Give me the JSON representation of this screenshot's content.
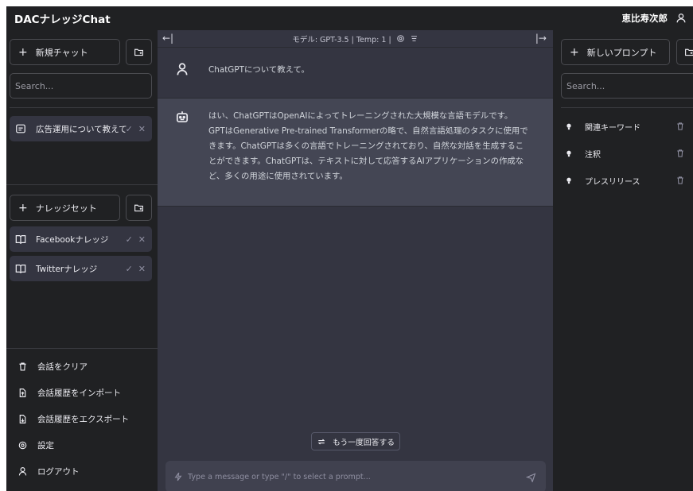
{
  "app": {
    "title": "DACナレッジChat",
    "user_name": "恵比寿次郎"
  },
  "left": {
    "new_chat_label": "新規チャット",
    "search_placeholder": "Search...",
    "conversations": [
      {
        "label": "広告運用について教えて"
      }
    ],
    "knowledge_set_label": "ナレッジセット",
    "knowledge": [
      {
        "label": "Facebookナレッジ"
      },
      {
        "label": "Twitterナレッジ"
      }
    ],
    "menu": {
      "clear": "会話をクリア",
      "import": "会話履歴をインポート",
      "export": "会話履歴をエクスポート",
      "settings": "設定",
      "logout": "ログアウト"
    }
  },
  "center": {
    "header": "モデル: GPT-3.5 | Temp: 1 |",
    "user_message": "ChatGPTについて教えて。",
    "bot_lines": [
      "はい、ChatGPTはOpenAIによってトレーニングされた大規模な言語モデルです。",
      "GPTはGenerative Pre-trained Transformerの略で、自然言語処理のタスクに使用で",
      "きます。ChatGPTは多くの言語でトレーニングされており、自然な対話を生成するこ",
      "とができます。ChatGPTは、テキストに対して応答するAIアプリケーションの作成な",
      "ど、多くの用途に使用されています。"
    ],
    "regenerate_label": "もう一度回答する",
    "input_placeholder": "Type a message or type \"/\" to select a prompt..."
  },
  "right": {
    "new_prompt_label": "新しいプロンプト",
    "search_placeholder": "Search...",
    "prompts": [
      {
        "label": "関連キーワード"
      },
      {
        "label": "注釈"
      },
      {
        "label": "プレスリリース"
      }
    ]
  },
  "colors": {
    "sidebar_bg": "#202123",
    "chat_bg": "#343541",
    "bot_bg": "#444654",
    "input_bg": "#40414f"
  }
}
